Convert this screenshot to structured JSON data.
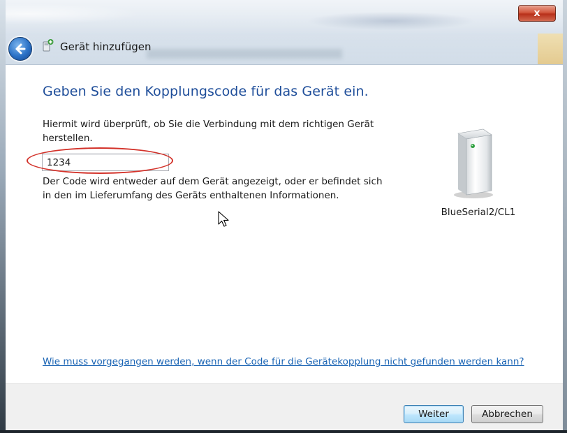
{
  "window": {
    "title": "Gerät hinzufügen",
    "close_glyph": "x"
  },
  "main": {
    "heading": "Geben Sie den Kopplungscode für das Gerät ein.",
    "description": "Hiermit wird überprüft, ob Sie die Verbindung mit dem richtigen Gerät herstellen.",
    "code_value": "1234",
    "hint": "Der Code wird entweder auf dem Gerät angezeigt, oder er befindet sich in den im Lieferumfang des Geräts enthaltenen Informationen.",
    "device_name": "BlueSerial2/CL1",
    "help_link": "Wie muss vorgegangen werden, wenn der Code für die Gerätekopplung nicht gefunden werden kann?"
  },
  "footer": {
    "next_label": "Weiter",
    "cancel_label": "Abbrechen"
  },
  "icons": {
    "back": "back-arrow-icon",
    "window": "add-device-icon",
    "device": "device-icon",
    "cursor": "mouse-pointer-icon"
  },
  "colors": {
    "heading": "#1f4e9a",
    "link": "#1a64b4",
    "annotation": "#d3322a",
    "close": "#c7452d"
  }
}
